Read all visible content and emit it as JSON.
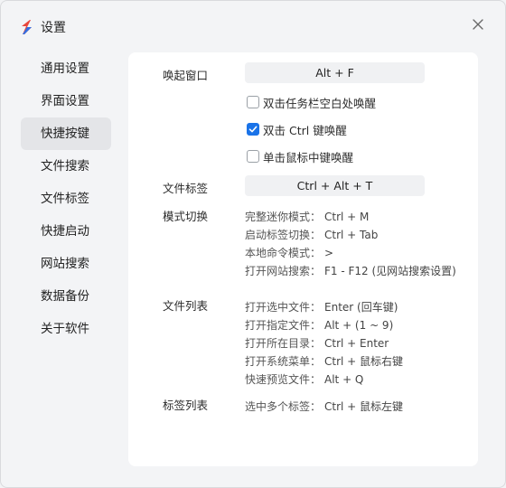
{
  "window": {
    "title": "设置"
  },
  "colors": {
    "accent": "#1a73e8",
    "icon_red": "#e8473c",
    "icon_blue": "#2f6fe4"
  },
  "sidebar": {
    "items": [
      {
        "label": "通用设置"
      },
      {
        "label": "界面设置"
      },
      {
        "label": "快捷按键"
      },
      {
        "label": "文件搜索"
      },
      {
        "label": "文件标签"
      },
      {
        "label": "快捷启动"
      },
      {
        "label": "网站搜索"
      },
      {
        "label": "数据备份"
      },
      {
        "label": "关于软件"
      }
    ],
    "active_index": 2
  },
  "panel": {
    "wake_window": {
      "label": "唤起窗口",
      "shortcut": "Alt + F"
    },
    "options": [
      {
        "label": "双击任务栏空白处唤醒",
        "checked": false
      },
      {
        "label": "双击 Ctrl 键唤醒",
        "checked": true
      },
      {
        "label": "单击鼠标中键唤醒",
        "checked": false
      }
    ],
    "file_tag": {
      "label": "文件标签",
      "shortcut": "Ctrl + Alt + T"
    },
    "mode_switch": {
      "label": "模式切换",
      "rows": [
        {
          "key": "完整迷你模式：",
          "value": "Ctrl + M"
        },
        {
          "key": "启动标签切换：",
          "value": "Ctrl + Tab"
        },
        {
          "key": "本地命令模式：",
          "value": ">"
        },
        {
          "key": "打开网站搜索：",
          "value": "F1 - F12 (见网站搜索设置)"
        }
      ]
    },
    "file_list": {
      "label": "文件列表",
      "rows": [
        {
          "key": "打开选中文件：",
          "value": "Enter (回车键)"
        },
        {
          "key": "打开指定文件：",
          "value": "Alt + (1 ~ 9)"
        },
        {
          "key": "打开所在目录：",
          "value": "Ctrl + Enter"
        },
        {
          "key": "打开系统菜单：",
          "value": "Ctrl + 鼠标右键"
        },
        {
          "key": "快速预览文件：",
          "value": "Alt + Q"
        }
      ]
    },
    "tag_list": {
      "label": "标签列表",
      "rows": [
        {
          "key": "选中多个标签：",
          "value": "Ctrl + 鼠标左键"
        }
      ]
    }
  }
}
